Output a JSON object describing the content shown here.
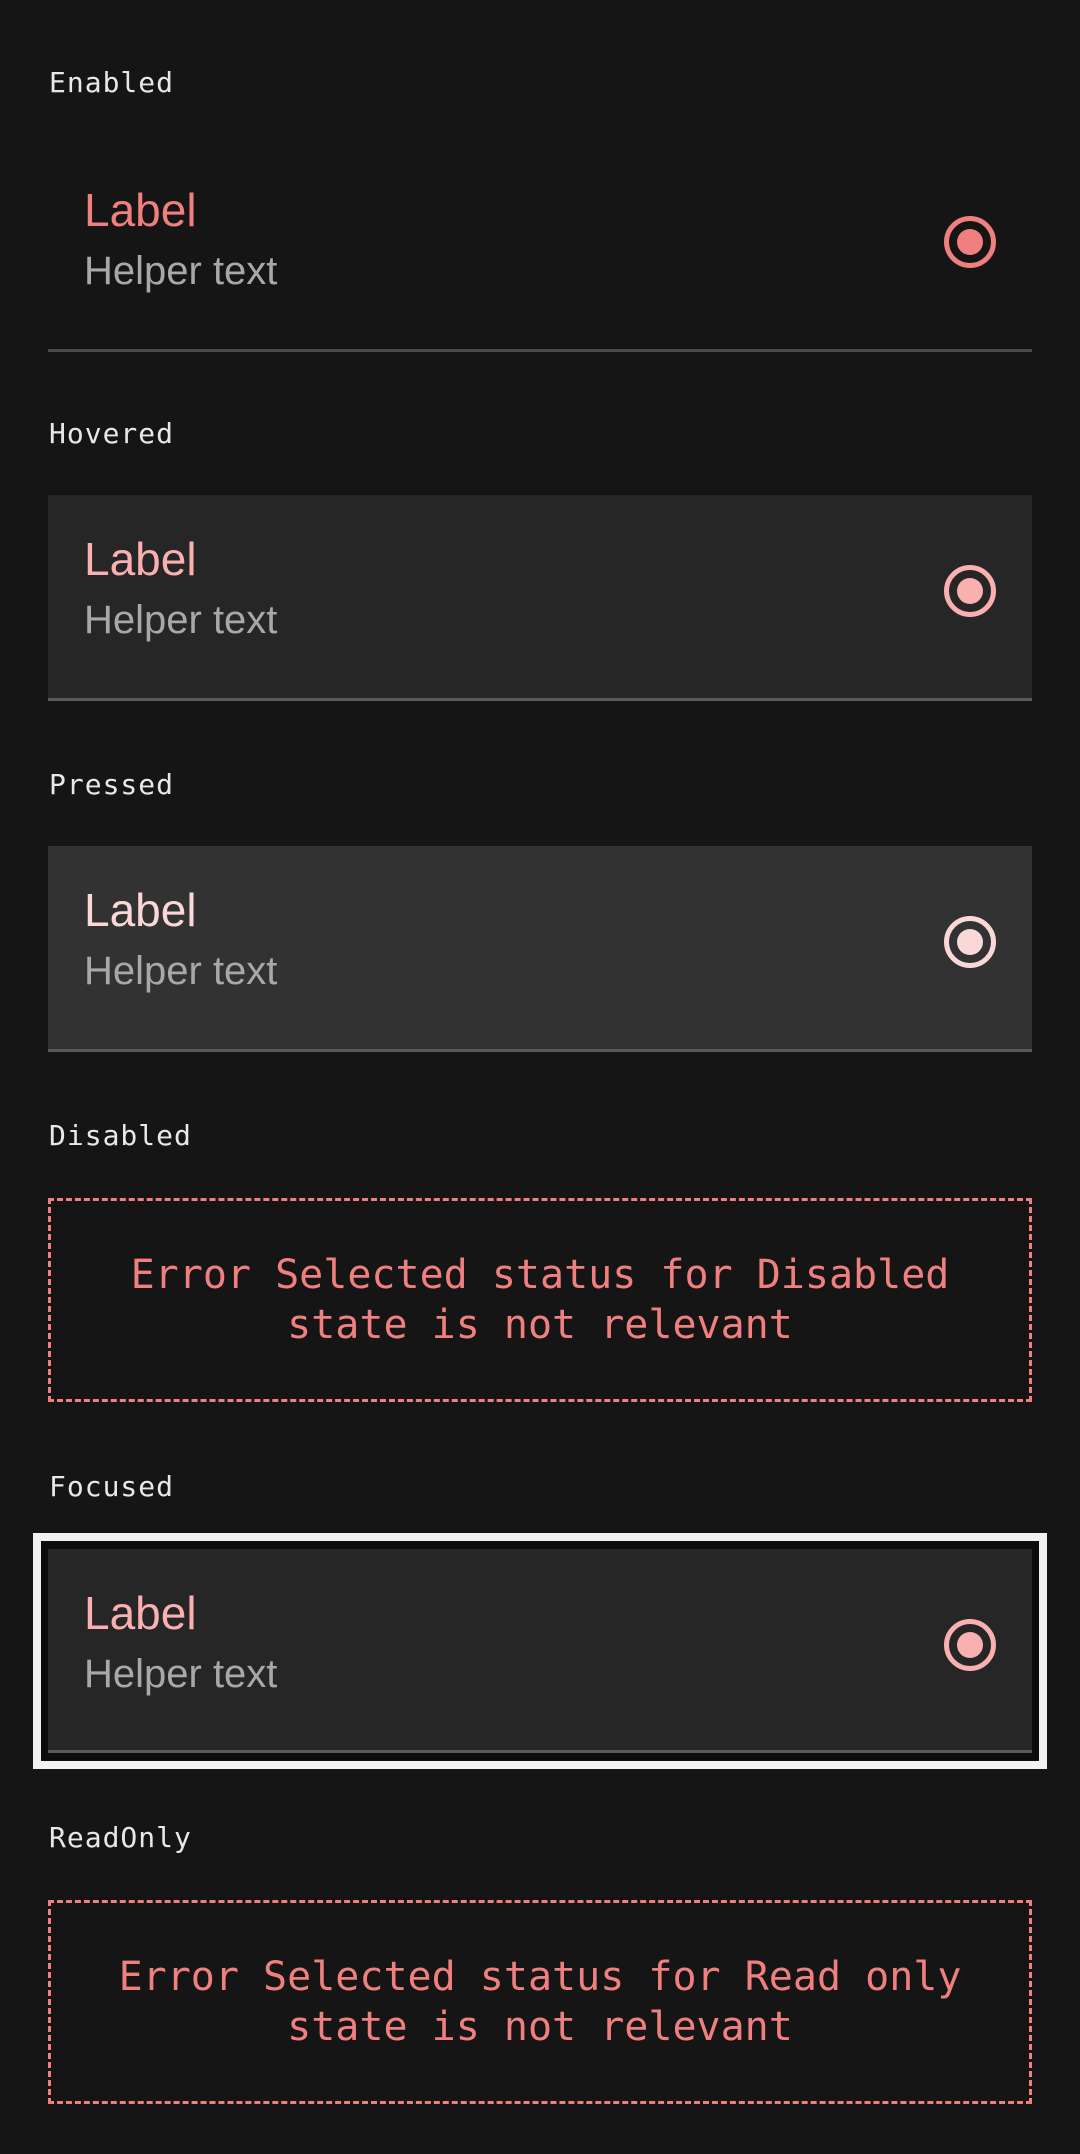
{
  "colors": {
    "background": "#151515",
    "enabled_accent": "#f07f7f",
    "hovered_accent": "#f9b0b0",
    "pressed_accent": "#fbd8d8",
    "focused_accent": "#f9b0b0",
    "helper_text": "#a8a8a8",
    "error_text": "#f07f7f"
  },
  "sections": {
    "enabled": {
      "title": "Enabled",
      "label": "Label",
      "helper": "Helper text",
      "radio_icon": "radio-selected-icon"
    },
    "hovered": {
      "title": "Hovered",
      "label": "Label",
      "helper": "Helper text",
      "radio_icon": "radio-selected-icon"
    },
    "pressed": {
      "title": "Pressed",
      "label": "Label",
      "helper": "Helper text",
      "radio_icon": "radio-selected-icon"
    },
    "disabled": {
      "title": "Disabled",
      "error": "Error Selected status for Disabled state is not relevant"
    },
    "focused": {
      "title": "Focused",
      "label": "Label",
      "helper": "Helper text",
      "radio_icon": "radio-selected-icon"
    },
    "readonly": {
      "title": "ReadOnly",
      "error": "Error Selected status for Read only state is not relevant"
    }
  }
}
